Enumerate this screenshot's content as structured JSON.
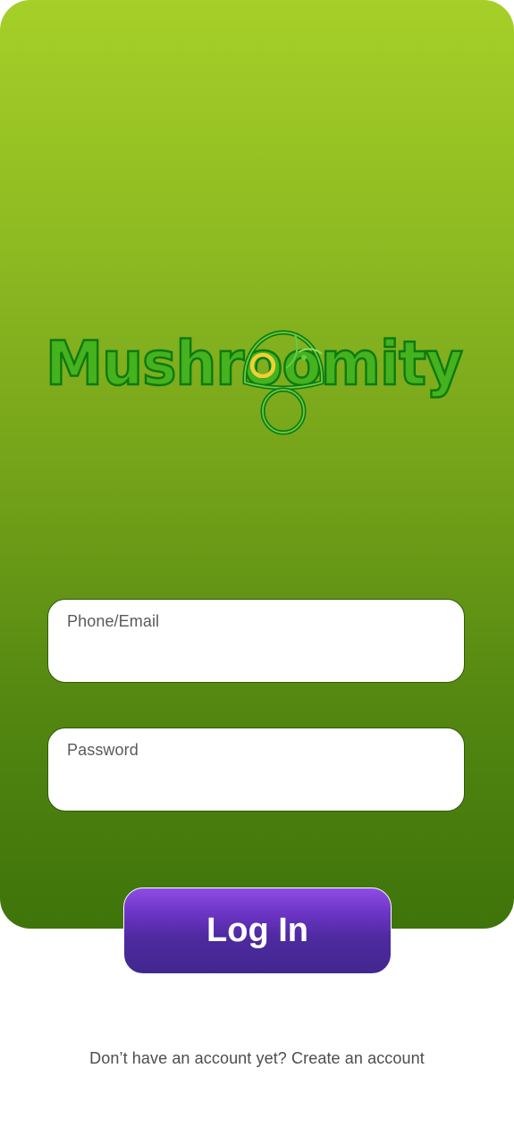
{
  "brand": {
    "name": "Mushroomity",
    "logo_icon": "mushroom-icon",
    "colors": {
      "gradient_top": "#a6cf28",
      "gradient_bottom": "#3e740a",
      "logo_fill": "#45b21e",
      "logo_outline": "#0d7a10",
      "accent_eye": "#f0d034"
    }
  },
  "login": {
    "phone_email_label": "Phone/Email",
    "phone_email_value": "",
    "password_label": "Password",
    "password_value": "",
    "submit_label": "Log In",
    "submit_colors": {
      "top": "#8e4de4",
      "bottom": "#42278f"
    }
  },
  "footer": {
    "prompt_text": "Don’t have an account yet?",
    "create_account_link": "Create an account"
  }
}
